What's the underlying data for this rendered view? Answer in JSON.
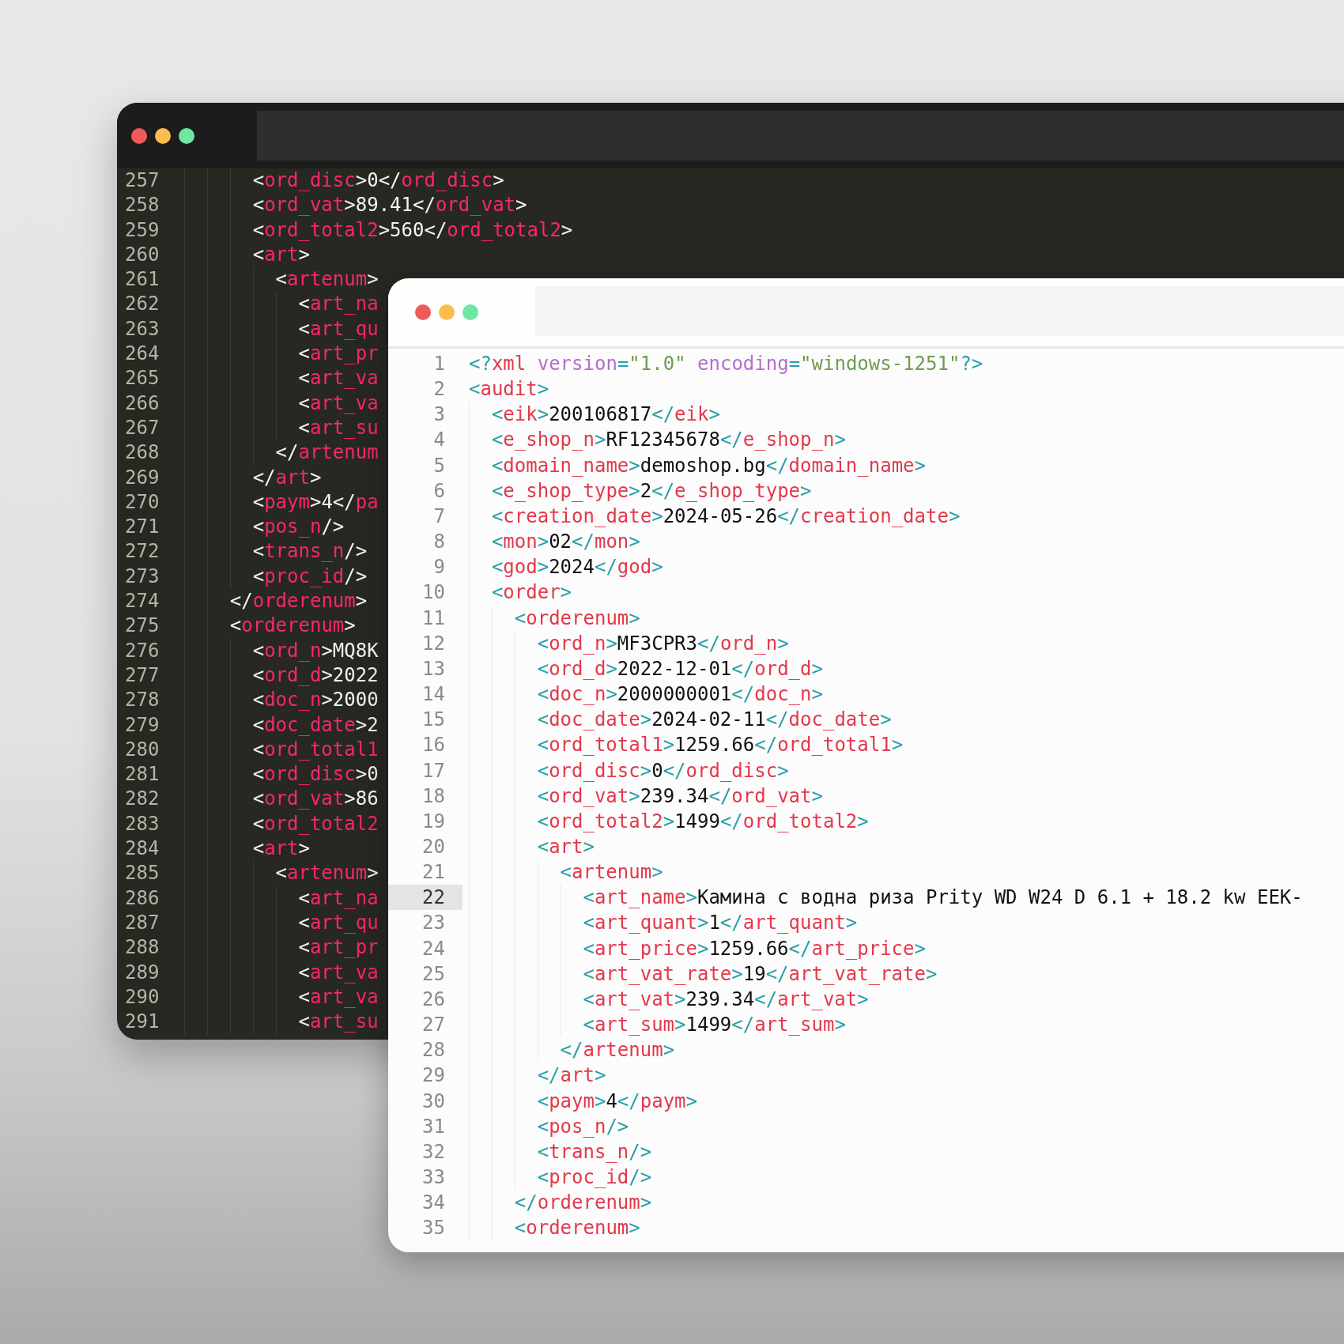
{
  "back_window": {
    "lines": [
      {
        "number": "257",
        "code": "      <ord_disc>0</ord_disc>"
      },
      {
        "number": "258",
        "code": "      <ord_vat>89.41</ord_vat>"
      },
      {
        "number": "259",
        "code": "      <ord_total2>560</ord_total2>"
      },
      {
        "number": "260",
        "code": "      <art>"
      },
      {
        "number": "261",
        "code": "        <artenum>"
      },
      {
        "number": "262",
        "code": "          <art_na"
      },
      {
        "number": "263",
        "code": "          <art_qu"
      },
      {
        "number": "264",
        "code": "          <art_pr"
      },
      {
        "number": "265",
        "code": "          <art_va"
      },
      {
        "number": "266",
        "code": "          <art_va"
      },
      {
        "number": "267",
        "code": "          <art_su"
      },
      {
        "number": "268",
        "code": "        </artenum"
      },
      {
        "number": "269",
        "code": "      </art>"
      },
      {
        "number": "270",
        "code": "      <paym>4</pa"
      },
      {
        "number": "271",
        "code": "      <pos_n/>"
      },
      {
        "number": "272",
        "code": "      <trans_n/>"
      },
      {
        "number": "273",
        "code": "      <proc_id/>"
      },
      {
        "number": "274",
        "code": "    </orderenum>"
      },
      {
        "number": "275",
        "code": "    <orderenum>"
      },
      {
        "number": "276",
        "code": "      <ord_n>MQ8K"
      },
      {
        "number": "277",
        "code": "      <ord_d>2022"
      },
      {
        "number": "278",
        "code": "      <doc_n>2000"
      },
      {
        "number": "279",
        "code": "      <doc_date>2"
      },
      {
        "number": "280",
        "code": "      <ord_total1"
      },
      {
        "number": "281",
        "code": "      <ord_disc>0"
      },
      {
        "number": "282",
        "code": "      <ord_vat>86"
      },
      {
        "number": "283",
        "code": "      <ord_total2"
      },
      {
        "number": "284",
        "code": "      <art>"
      },
      {
        "number": "285",
        "code": "        <artenum>"
      },
      {
        "number": "286",
        "code": "          <art_na"
      },
      {
        "number": "287",
        "code": "          <art_qu"
      },
      {
        "number": "288",
        "code": "          <art_pr"
      },
      {
        "number": "289",
        "code": "          <art_va"
      },
      {
        "number": "290",
        "code": "          <art_va"
      },
      {
        "number": "291",
        "code": "          <art_su"
      }
    ]
  },
  "front_window": {
    "lines": [
      {
        "number": "1",
        "code": "<?xml version=\"1.0\" encoding=\"windows-1251\"?>",
        "current": false
      },
      {
        "number": "2",
        "code": "<audit>",
        "current": false
      },
      {
        "number": "3",
        "code": "  <eik>200106817</eik>",
        "current": false
      },
      {
        "number": "4",
        "code": "  <e_shop_n>RF12345678</e_shop_n>",
        "current": false
      },
      {
        "number": "5",
        "code": "  <domain_name>demoshop.bg</domain_name>",
        "current": false
      },
      {
        "number": "6",
        "code": "  <e_shop_type>2</e_shop_type>",
        "current": false
      },
      {
        "number": "7",
        "code": "  <creation_date>2024-05-26</creation_date>",
        "current": false
      },
      {
        "number": "8",
        "code": "  <mon>02</mon>",
        "current": false
      },
      {
        "number": "9",
        "code": "  <god>2024</god>",
        "current": false
      },
      {
        "number": "10",
        "code": "  <order>",
        "current": false
      },
      {
        "number": "11",
        "code": "    <orderenum>",
        "current": false
      },
      {
        "number": "12",
        "code": "      <ord_n>MF3CPR3</ord_n>",
        "current": false
      },
      {
        "number": "13",
        "code": "      <ord_d>2022-12-01</ord_d>",
        "current": false
      },
      {
        "number": "14",
        "code": "      <doc_n>2000000001</doc_n>",
        "current": false
      },
      {
        "number": "15",
        "code": "      <doc_date>2024-02-11</doc_date>",
        "current": false
      },
      {
        "number": "16",
        "code": "      <ord_total1>1259.66</ord_total1>",
        "current": false
      },
      {
        "number": "17",
        "code": "      <ord_disc>0</ord_disc>",
        "current": false
      },
      {
        "number": "18",
        "code": "      <ord_vat>239.34</ord_vat>",
        "current": false
      },
      {
        "number": "19",
        "code": "      <ord_total2>1499</ord_total2>",
        "current": false
      },
      {
        "number": "20",
        "code": "      <art>",
        "current": false
      },
      {
        "number": "21",
        "code": "        <artenum>",
        "current": false
      },
      {
        "number": "22",
        "code": "          <art_name>Камина с водна риза Prity WD W24 D 6.1 + 18.2 kw EEK-",
        "current": true
      },
      {
        "number": "23",
        "code": "          <art_quant>1</art_quant>",
        "current": false
      },
      {
        "number": "24",
        "code": "          <art_price>1259.66</art_price>",
        "current": false
      },
      {
        "number": "25",
        "code": "          <art_vat_rate>19</art_vat_rate>",
        "current": false
      },
      {
        "number": "26",
        "code": "          <art_vat>239.34</art_vat>",
        "current": false
      },
      {
        "number": "27",
        "code": "          <art_sum>1499</art_sum>",
        "current": false
      },
      {
        "number": "28",
        "code": "        </artenum>",
        "current": false
      },
      {
        "number": "29",
        "code": "      </art>",
        "current": false
      },
      {
        "number": "30",
        "code": "      <paym>4</paym>",
        "current": false
      },
      {
        "number": "31",
        "code": "      <pos_n/>",
        "current": false
      },
      {
        "number": "32",
        "code": "      <trans_n/>",
        "current": false
      },
      {
        "number": "33",
        "code": "      <proc_id/>",
        "current": false
      },
      {
        "number": "34",
        "code": "    </orderenum>",
        "current": false
      },
      {
        "number": "35",
        "code": "    <orderenum>",
        "current": false
      }
    ]
  }
}
